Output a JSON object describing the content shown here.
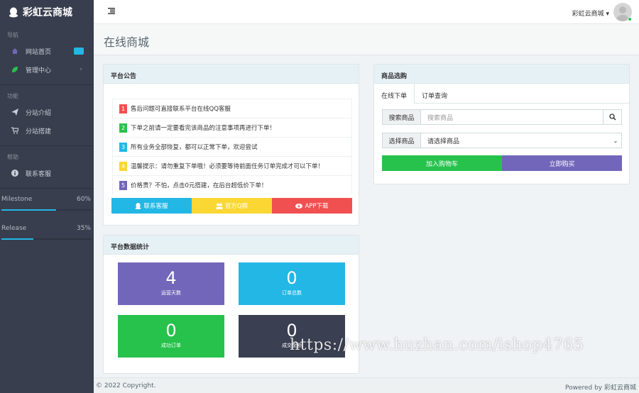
{
  "sidebar": {
    "brand": "彩虹云商城",
    "sections": [
      {
        "title": "导航",
        "items": [
          {
            "label": "网站首页",
            "icon": "home-icon"
          },
          {
            "label": "管理中心",
            "icon": "leaf-icon"
          }
        ]
      },
      {
        "title": "功能",
        "items": [
          {
            "label": "分站介绍",
            "icon": "paper-plane-icon"
          },
          {
            "label": "分站搭建",
            "icon": "cart-icon"
          }
        ]
      },
      {
        "title": "帮助",
        "items": [
          {
            "label": "联系客服",
            "icon": "info-icon"
          }
        ]
      }
    ],
    "progress": [
      {
        "label": "Milestone",
        "value": "60%",
        "fraction": 0.6
      },
      {
        "label": "Release",
        "value": "35%",
        "fraction": 0.35
      }
    ]
  },
  "header": {
    "site_name": "彩虹云商城"
  },
  "page": {
    "title": "在线商城"
  },
  "announcement": {
    "title": "平台公告",
    "items": [
      {
        "num": "1",
        "text": "售后问题可直接联系平台在线QQ客服",
        "color": "#f05050"
      },
      {
        "num": "2",
        "text": "下单之前请一定要看完该商品的注意事项再进行下单！",
        "color": "#27c24c"
      },
      {
        "num": "3",
        "text": "所有业务全部恢复，都可以正常下单，欢迎尝试",
        "color": "#23b7e5"
      },
      {
        "num": "4",
        "text": "温馨提示：请勿重复下单哦！必须要等待前面任务订单完成才可以下单！",
        "color": "#fad733"
      },
      {
        "num": "5",
        "text": "价格贵？不怕，点击0元搭建，在后台超低价下单！",
        "color": "#7266ba"
      }
    ],
    "buttons": [
      {
        "label": "联系客服",
        "color": "#23b7e5"
      },
      {
        "label": "官方Q群",
        "color": "#fad733"
      },
      {
        "label": "APP下载",
        "color": "#f05050"
      }
    ]
  },
  "stats": {
    "title": "平台数据统计",
    "cards": [
      {
        "value": "4",
        "label": "运营天数",
        "color": "#7266ba"
      },
      {
        "value": "0",
        "label": "订单总数",
        "color": "#23b7e5"
      },
      {
        "value": "0",
        "label": "成功订单",
        "color": "#27c24c"
      },
      {
        "value": "0",
        "label": "成交金额",
        "color": "#3a3f51"
      }
    ]
  },
  "shop": {
    "title": "商品选购",
    "tabs": [
      "在线下单",
      "订单查询"
    ],
    "search_label": "搜索商品",
    "search_placeholder": "搜索商品",
    "select_label": "选择商品",
    "select_value": "请选择商品",
    "add_cart": "加入购物车",
    "buy_now": "立即购买"
  },
  "footer": {
    "copyright": "© 2022 Copyright.",
    "powered": "Powered by 彩虹云商城"
  },
  "watermark": "https://www.huzhan.com/ishop4765"
}
